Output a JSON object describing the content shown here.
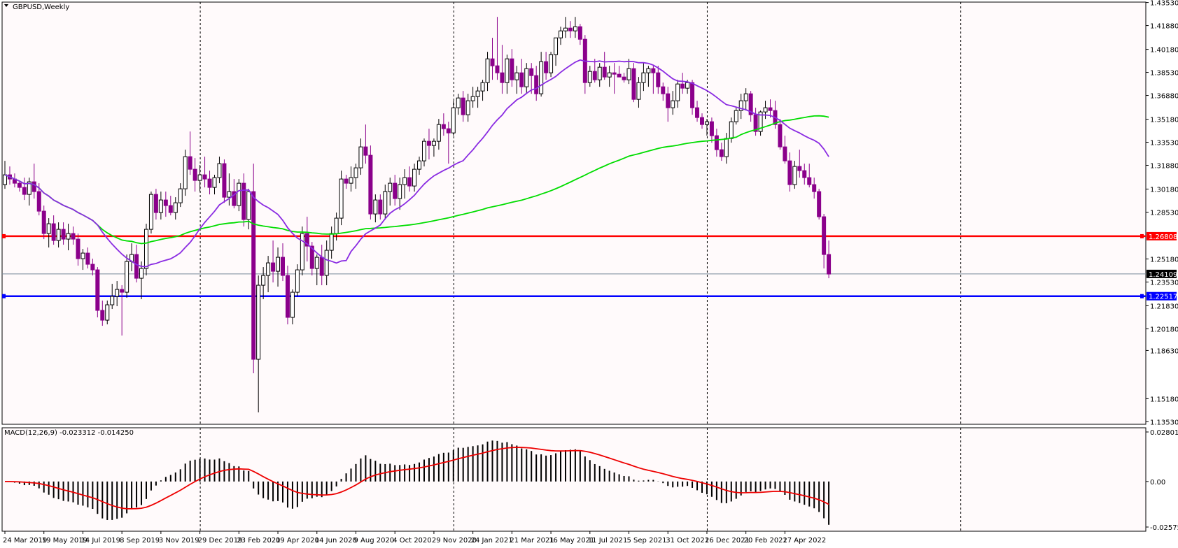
{
  "chart_data": {
    "type": "candlestick",
    "symbol_label": "GBPUSD,Weekly",
    "colors": {
      "background": "#fffafb",
      "bull_body": "#ffffff",
      "bear_body": "#8b008b",
      "candle_outline": "#000000",
      "ma_fast": "#8a2be2",
      "ma_slow": "#00dd00",
      "macd_signal": "#ee0000",
      "resistance": "#ff0000",
      "support": "#0000ff",
      "last_price_line": "#778899"
    },
    "y_axis": {
      "range": [
        1.1335,
        1.4356
      ],
      "ticks": [
        "1.43530",
        "1.41880",
        "1.40180",
        "1.38530",
        "1.36880",
        "1.35180",
        "1.33530",
        "1.31880",
        "1.30180",
        "1.28530",
        "1.25180",
        "1.23530",
        "1.21830",
        "1.20180",
        "1.18630",
        "1.15180",
        "1.13530"
      ]
    },
    "x_axis": {
      "ticks": [
        "24 Mar 2019",
        "19 May 2019",
        "14 Jul 2019",
        "8 Sep 2019",
        "3 Nov 2019",
        "29 Dec 2019",
        "23 Feb 2020",
        "19 Apr 2020",
        "14 Jun 2020",
        "9 Aug 2020",
        "4 Oct 2020",
        "29 Nov 2020",
        "24 Jan 2021",
        "21 Mar 2021",
        "16 May 2021",
        "11 Jul 2021",
        "5 Sep 2021",
        "31 Oct 2021",
        "26 Dec 2021",
        "20 Feb 2022",
        "17 Apr 2022"
      ],
      "period_separators_bar_index": [
        40,
        92,
        144,
        196
      ]
    },
    "horizontal_lines": [
      {
        "label": "1.26808",
        "value": 1.26808,
        "color": "#ff0000"
      },
      {
        "label": "1.22517",
        "value": 1.22517,
        "color": "#0000ff"
      }
    ],
    "last_price": {
      "label": "1.24109",
      "value": 1.24109
    },
    "ohlc": [
      [
        1.305,
        1.322,
        1.302,
        1.312
      ],
      [
        1.312,
        1.318,
        1.305,
        1.309
      ],
      [
        1.309,
        1.313,
        1.303,
        1.306
      ],
      [
        1.306,
        1.308,
        1.3,
        1.303
      ],
      [
        1.303,
        1.31,
        1.294,
        1.298
      ],
      [
        1.298,
        1.31,
        1.29,
        1.307
      ],
      [
        1.307,
        1.32,
        1.295,
        1.3
      ],
      [
        1.3,
        1.306,
        1.283,
        1.286
      ],
      [
        1.286,
        1.29,
        1.266,
        1.27
      ],
      [
        1.27,
        1.281,
        1.26,
        1.277
      ],
      [
        1.277,
        1.283,
        1.262,
        1.265
      ],
      [
        1.265,
        1.278,
        1.26,
        1.273
      ],
      [
        1.273,
        1.278,
        1.262,
        1.266
      ],
      [
        1.266,
        1.277,
        1.258,
        1.27
      ],
      [
        1.27,
        1.275,
        1.262,
        1.266
      ],
      [
        1.266,
        1.27,
        1.247,
        1.252
      ],
      [
        1.252,
        1.259,
        1.244,
        1.256
      ],
      [
        1.256,
        1.26,
        1.245,
        1.248
      ],
      [
        1.248,
        1.252,
        1.24,
        1.244
      ],
      [
        1.244,
        1.246,
        1.21,
        1.215
      ],
      [
        1.215,
        1.222,
        1.204,
        1.208
      ],
      [
        1.208,
        1.222,
        1.205,
        1.219
      ],
      [
        1.219,
        1.234,
        1.216,
        1.225
      ],
      [
        1.225,
        1.236,
        1.218,
        1.23
      ],
      [
        1.23,
        1.233,
        1.197,
        1.228
      ],
      [
        1.228,
        1.255,
        1.224,
        1.25
      ],
      [
        1.25,
        1.263,
        1.243,
        1.255
      ],
      [
        1.255,
        1.262,
        1.235,
        1.238
      ],
      [
        1.238,
        1.25,
        1.223,
        1.245
      ],
      [
        1.245,
        1.277,
        1.24,
        1.273
      ],
      [
        1.273,
        1.3,
        1.27,
        1.298
      ],
      [
        1.298,
        1.302,
        1.28,
        1.285
      ],
      [
        1.285,
        1.3,
        1.28,
        1.294
      ],
      [
        1.294,
        1.3,
        1.282,
        1.29
      ],
      [
        1.29,
        1.297,
        1.283,
        1.285
      ],
      [
        1.285,
        1.296,
        1.28,
        1.292
      ],
      [
        1.292,
        1.306,
        1.289,
        1.302
      ],
      [
        1.302,
        1.33,
        1.297,
        1.325
      ],
      [
        1.325,
        1.343,
        1.312,
        1.316
      ],
      [
        1.316,
        1.324,
        1.3,
        1.308
      ],
      [
        1.308,
        1.319,
        1.3,
        1.312
      ],
      [
        1.312,
        1.325,
        1.303,
        1.309
      ],
      [
        1.309,
        1.315,
        1.298,
        1.303
      ],
      [
        1.303,
        1.312,
        1.298,
        1.31
      ],
      [
        1.31,
        1.325,
        1.306,
        1.32
      ],
      [
        1.32,
        1.323,
        1.292,
        1.296
      ],
      [
        1.296,
        1.313,
        1.29,
        1.3
      ],
      [
        1.3,
        1.309,
        1.288,
        1.29
      ],
      [
        1.29,
        1.309,
        1.286,
        1.306
      ],
      [
        1.306,
        1.313,
        1.275,
        1.28
      ],
      [
        1.28,
        1.302,
        1.273,
        1.3
      ],
      [
        1.3,
        1.32,
        1.17,
        1.18
      ],
      [
        1.18,
        1.24,
        1.142,
        1.233
      ],
      [
        1.233,
        1.246,
        1.223,
        1.24
      ],
      [
        1.24,
        1.254,
        1.228,
        1.249
      ],
      [
        1.249,
        1.265,
        1.235,
        1.243
      ],
      [
        1.243,
        1.26,
        1.232,
        1.253
      ],
      [
        1.253,
        1.263,
        1.236,
        1.24
      ],
      [
        1.24,
        1.247,
        1.205,
        1.21
      ],
      [
        1.21,
        1.23,
        1.205,
        1.228
      ],
      [
        1.228,
        1.248,
        1.225,
        1.244
      ],
      [
        1.244,
        1.275,
        1.24,
        1.27
      ],
      [
        1.27,
        1.282,
        1.25,
        1.261
      ],
      [
        1.261,
        1.264,
        1.24,
        1.245
      ],
      [
        1.245,
        1.255,
        1.233,
        1.253
      ],
      [
        1.253,
        1.262,
        1.233,
        1.24
      ],
      [
        1.24,
        1.265,
        1.233,
        1.258
      ],
      [
        1.258,
        1.275,
        1.252,
        1.27
      ],
      [
        1.27,
        1.285,
        1.265,
        1.281
      ],
      [
        1.281,
        1.315,
        1.276,
        1.309
      ],
      [
        1.309,
        1.312,
        1.302,
        1.306
      ],
      [
        1.306,
        1.318,
        1.3,
        1.31
      ],
      [
        1.31,
        1.32,
        1.302,
        1.317
      ],
      [
        1.317,
        1.338,
        1.312,
        1.332
      ],
      [
        1.332,
        1.348,
        1.32,
        1.326
      ],
      [
        1.326,
        1.333,
        1.28,
        1.284
      ],
      [
        1.284,
        1.298,
        1.278,
        1.294
      ],
      [
        1.294,
        1.298,
        1.28,
        1.284
      ],
      [
        1.284,
        1.305,
        1.28,
        1.3
      ],
      [
        1.3,
        1.31,
        1.29,
        1.306
      ],
      [
        1.306,
        1.312,
        1.29,
        1.295
      ],
      [
        1.295,
        1.31,
        1.287,
        1.305
      ],
      [
        1.305,
        1.316,
        1.295,
        1.31
      ],
      [
        1.31,
        1.318,
        1.3,
        1.304
      ],
      [
        1.304,
        1.32,
        1.3,
        1.316
      ],
      [
        1.316,
        1.325,
        1.312,
        1.322
      ],
      [
        1.322,
        1.338,
        1.318,
        1.336
      ],
      [
        1.336,
        1.345,
        1.323,
        1.333
      ],
      [
        1.333,
        1.338,
        1.325,
        1.336
      ],
      [
        1.336,
        1.352,
        1.33,
        1.348
      ],
      [
        1.348,
        1.356,
        1.34,
        1.345
      ],
      [
        1.345,
        1.35,
        1.32,
        1.342
      ],
      [
        1.342,
        1.365,
        1.34,
        1.36
      ],
      [
        1.36,
        1.37,
        1.355,
        1.367
      ],
      [
        1.367,
        1.372,
        1.35,
        1.355
      ],
      [
        1.355,
        1.37,
        1.35,
        1.365
      ],
      [
        1.365,
        1.375,
        1.36,
        1.368
      ],
      [
        1.368,
        1.375,
        1.36,
        1.372
      ],
      [
        1.372,
        1.38,
        1.365,
        1.378
      ],
      [
        1.378,
        1.4,
        1.372,
        1.395
      ],
      [
        1.395,
        1.41,
        1.38,
        1.39
      ],
      [
        1.39,
        1.425,
        1.38,
        1.385
      ],
      [
        1.385,
        1.405,
        1.37,
        1.378
      ],
      [
        1.378,
        1.398,
        1.37,
        1.395
      ],
      [
        1.395,
        1.402,
        1.375,
        1.38
      ],
      [
        1.38,
        1.39,
        1.37,
        1.385
      ],
      [
        1.385,
        1.395,
        1.37,
        1.375
      ],
      [
        1.375,
        1.392,
        1.37,
        1.388
      ],
      [
        1.388,
        1.392,
        1.37,
        1.383
      ],
      [
        1.383,
        1.39,
        1.365,
        1.37
      ],
      [
        1.37,
        1.4,
        1.368,
        1.393
      ],
      [
        1.393,
        1.4,
        1.38,
        1.385
      ],
      [
        1.385,
        1.4,
        1.382,
        1.398
      ],
      [
        1.398,
        1.41,
        1.39,
        1.41
      ],
      [
        1.41,
        1.418,
        1.405,
        1.415
      ],
      [
        1.415,
        1.425,
        1.41,
        1.417
      ],
      [
        1.417,
        1.422,
        1.41,
        1.415
      ],
      [
        1.415,
        1.425,
        1.41,
        1.418
      ],
      [
        1.418,
        1.42,
        1.405,
        1.409
      ],
      [
        1.409,
        1.412,
        1.37,
        1.378
      ],
      [
        1.378,
        1.39,
        1.375,
        1.386
      ],
      [
        1.386,
        1.395,
        1.378,
        1.38
      ],
      [
        1.38,
        1.392,
        1.375,
        1.389
      ],
      [
        1.389,
        1.4,
        1.38,
        1.382
      ],
      [
        1.382,
        1.39,
        1.375,
        1.385
      ],
      [
        1.385,
        1.392,
        1.37,
        1.384
      ],
      [
        1.384,
        1.39,
        1.382,
        1.382
      ],
      [
        1.382,
        1.385,
        1.378,
        1.38
      ],
      [
        1.38,
        1.395,
        1.377,
        1.388
      ],
      [
        1.388,
        1.392,
        1.364,
        1.366
      ],
      [
        1.366,
        1.382,
        1.36,
        1.378
      ],
      [
        1.378,
        1.392,
        1.372,
        1.385
      ],
      [
        1.385,
        1.39,
        1.375,
        1.388
      ],
      [
        1.388,
        1.39,
        1.37,
        1.385
      ],
      [
        1.385,
        1.39,
        1.37,
        1.375
      ],
      [
        1.375,
        1.378,
        1.365,
        1.37
      ],
      [
        1.37,
        1.375,
        1.35,
        1.36
      ],
      [
        1.36,
        1.372,
        1.355,
        1.365
      ],
      [
        1.365,
        1.38,
        1.36,
        1.377
      ],
      [
        1.377,
        1.385,
        1.37,
        1.374
      ],
      [
        1.374,
        1.38,
        1.37,
        1.378
      ],
      [
        1.378,
        1.38,
        1.355,
        1.36
      ],
      [
        1.36,
        1.365,
        1.35,
        1.353
      ],
      [
        1.353,
        1.356,
        1.345,
        1.348
      ],
      [
        1.348,
        1.352,
        1.34,
        1.35
      ],
      [
        1.35,
        1.353,
        1.335,
        1.34
      ],
      [
        1.34,
        1.345,
        1.325,
        1.33
      ],
      [
        1.33,
        1.335,
        1.322,
        1.325
      ],
      [
        1.325,
        1.342,
        1.32,
        1.338
      ],
      [
        1.338,
        1.353,
        1.335,
        1.35
      ],
      [
        1.35,
        1.36,
        1.348,
        1.358
      ],
      [
        1.358,
        1.37,
        1.352,
        1.365
      ],
      [
        1.365,
        1.374,
        1.358,
        1.37
      ],
      [
        1.37,
        1.372,
        1.35,
        1.355
      ],
      [
        1.355,
        1.36,
        1.34,
        1.343
      ],
      [
        1.343,
        1.358,
        1.34,
        1.357
      ],
      [
        1.357,
        1.365,
        1.352,
        1.36
      ],
      [
        1.36,
        1.366,
        1.353,
        1.358
      ],
      [
        1.358,
        1.365,
        1.345,
        1.348
      ],
      [
        1.348,
        1.352,
        1.33,
        1.332
      ],
      [
        1.332,
        1.34,
        1.32,
        1.322
      ],
      [
        1.322,
        1.328,
        1.3,
        1.305
      ],
      [
        1.305,
        1.322,
        1.302,
        1.318
      ],
      [
        1.318,
        1.33,
        1.31,
        1.315
      ],
      [
        1.315,
        1.32,
        1.305,
        1.31
      ],
      [
        1.31,
        1.32,
        1.303,
        1.305
      ],
      [
        1.305,
        1.31,
        1.295,
        1.3
      ],
      [
        1.3,
        1.302,
        1.28,
        1.282
      ],
      [
        1.282,
        1.284,
        1.245,
        1.255
      ],
      [
        1.255,
        1.265,
        1.238,
        1.241
      ]
    ],
    "ma_fast": {
      "type": "moving-average",
      "period": 20
    },
    "ma_slow": {
      "type": "moving-average",
      "period": 100
    },
    "macd": {
      "label": "MACD(12,26,9) -0.023312 -0.014250",
      "y_axis_ticks": [
        "0.028019",
        "0.00",
        "-0.025757"
      ],
      "range": [
        -0.025757,
        0.028019
      ]
    }
  }
}
